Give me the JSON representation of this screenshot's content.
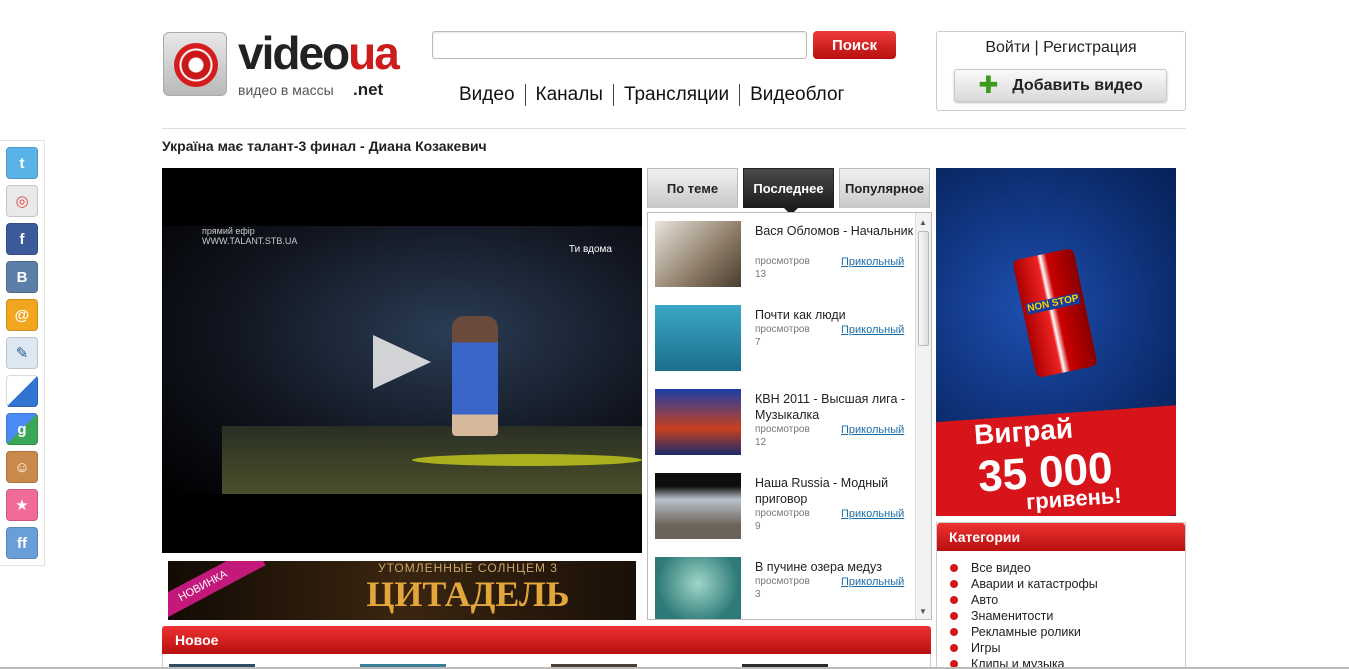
{
  "logo": {
    "brand_main": "video",
    "brand_accent": "ua",
    "tagline": "видео в массы",
    "domain": ".net"
  },
  "search": {
    "placeholder": "",
    "button_label": "Поиск"
  },
  "nav": [
    "Видео",
    "Каналы",
    "Трансляции",
    "Видеоблог"
  ],
  "auth": {
    "login": "Войти",
    "separator": "|",
    "register": "Регистрация"
  },
  "add_video_label": "Добавить видео",
  "video_title": "Україна має талант-3 финал - Диана Козакевич",
  "player": {
    "live_label": "прямий ефір",
    "site": "WWW.TALANT.STB.UA",
    "channel": "Ти вдома"
  },
  "promo": {
    "corner": "НОВИНКА",
    "subtitle": "УТОМЛЕННЫЕ СОЛНЦЕМ 3",
    "title": "ЦИТАДЕЛЬ"
  },
  "tabs": [
    "По теме",
    "Последнее",
    "Популярное"
  ],
  "active_tab": "Последнее",
  "video_list": [
    {
      "title": "Вася Обломов - Начальник",
      "views_label": "просмотров",
      "views": "13",
      "category": "Прикольный"
    },
    {
      "title": "Почти как люди",
      "views_label": "просмотров",
      "views": "7",
      "category": "Прикольный"
    },
    {
      "title": "КВН 2011 - Высшая лига - Музыкалка",
      "views_label": "просмотров",
      "views": "12",
      "category": "Прикольный"
    },
    {
      "title": "Наша Russia - Модный приговор",
      "views_label": "просмотров",
      "views": "9",
      "category": "Прикольный"
    },
    {
      "title": "В пучине озера медуз",
      "views_label": "просмотров",
      "views": "3",
      "category": "Прикольный"
    }
  ],
  "ad": {
    "line1": "Виграй",
    "line2": "35 000",
    "line3": "гривень!"
  },
  "categories": {
    "title": "Категории",
    "items": [
      "Все видео",
      "Аварии и катастрофы",
      "Авто",
      "Знаменитости",
      "Рекламные ролики",
      "Игры",
      "Клипы и музыка"
    ]
  },
  "new_section_title": "Новое",
  "colors": {
    "accent_red": "#cc1c1c",
    "link_blue": "#1a6ea8",
    "header_red_top": "#ee3232",
    "header_red_bottom": "#b80f0f"
  }
}
